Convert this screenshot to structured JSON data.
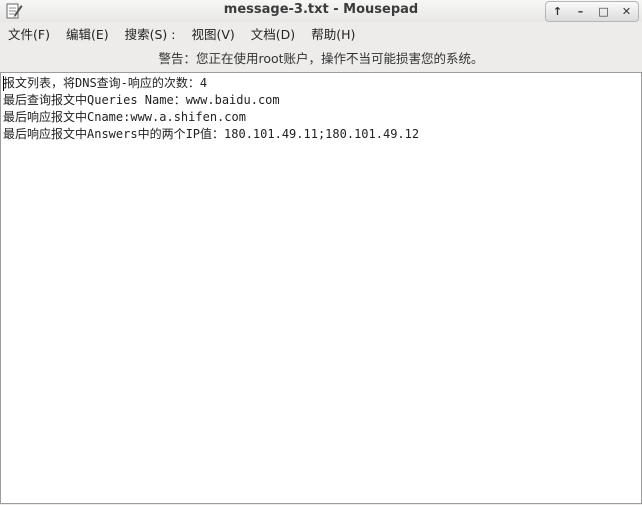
{
  "window": {
    "title": "message-3.txt - Mousepad",
    "controls": [
      "up-icon",
      "minimize-icon",
      "maximize-icon",
      "close-icon"
    ]
  },
  "menu": [
    {
      "label": "文件(F)"
    },
    {
      "label": "编辑(E)"
    },
    {
      "label": "搜索(S) :"
    },
    {
      "label": "视图(V)"
    },
    {
      "label": "文档(D)"
    },
    {
      "label": "帮助(H)"
    }
  ],
  "warning": "警告：您正在使用root账户，操作不当可能损害您的系统。",
  "editor": {
    "lines": [
      "报文列表，将DNS查询-响应的次数：4",
      "最后查询报文中Queries Name：www.baidu.com",
      "最后响应报文中Cname:www.a.shifen.com",
      "最后响应报文中Answers中的两个IP值：180.101.49.11;180.101.49.12"
    ]
  }
}
